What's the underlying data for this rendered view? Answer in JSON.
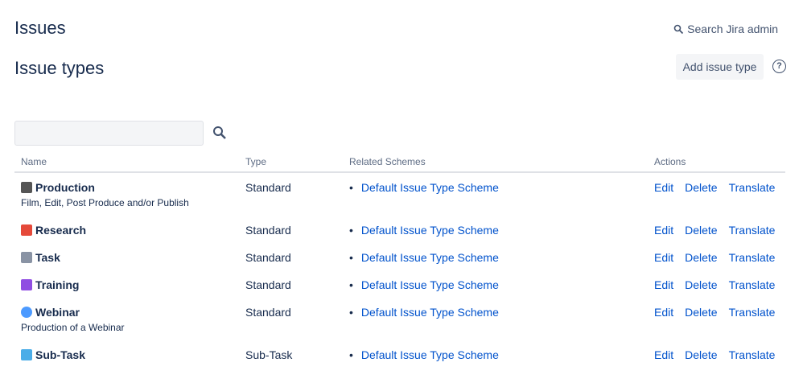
{
  "header": {
    "title": "Issues",
    "search_admin": "Search Jira admin",
    "subtitle": "Issue types",
    "add_button": "Add issue type",
    "help": "?"
  },
  "filter": {
    "placeholder": "",
    "value": ""
  },
  "table": {
    "columns": [
      "Name",
      "Type",
      "Related Schemes",
      "Actions"
    ],
    "actions": [
      "Edit",
      "Delete",
      "Translate"
    ],
    "rows": [
      {
        "name": "Production",
        "description": "Film, Edit, Post Produce and/or Publish",
        "type": "Standard",
        "scheme": "Default Issue Type Scheme",
        "icon": "clapperboard-icon",
        "color": "#555555"
      },
      {
        "name": "Research",
        "description": "",
        "type": "Standard",
        "scheme": "Default Issue Type Scheme",
        "icon": "research-icon",
        "color": "#e5493a"
      },
      {
        "name": "Task",
        "description": "",
        "type": "Standard",
        "scheme": "Default Issue Type Scheme",
        "icon": "task-icon",
        "color": "#8993a4"
      },
      {
        "name": "Training",
        "description": "",
        "type": "Standard",
        "scheme": "Default Issue Type Scheme",
        "icon": "training-icon",
        "color": "#904ee2"
      },
      {
        "name": "Webinar",
        "description": "Production of a Webinar",
        "type": "Standard",
        "scheme": "Default Issue Type Scheme",
        "icon": "cloud-icon",
        "color": "#4c9aff"
      },
      {
        "name": "Sub-Task",
        "description": "",
        "type": "Sub-Task",
        "scheme": "Default Issue Type Scheme",
        "icon": "subtask-icon",
        "color": "#4bade8"
      }
    ]
  }
}
